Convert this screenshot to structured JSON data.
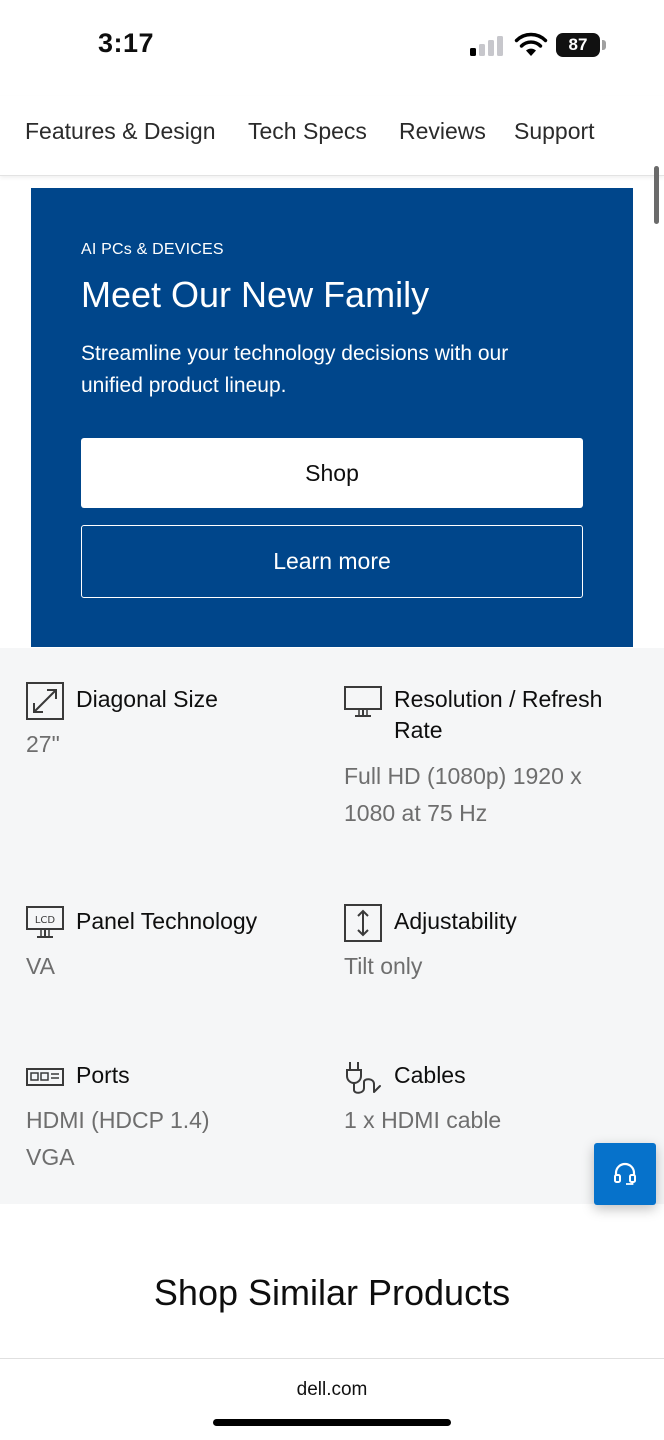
{
  "status_bar": {
    "time": "3:17",
    "battery": "87"
  },
  "tabs": [
    {
      "label": "Features & Design"
    },
    {
      "label": "Tech Specs"
    },
    {
      "label": "Reviews"
    },
    {
      "label": "Support"
    }
  ],
  "promo": {
    "eyebrow": "AI PCs & DEVICES",
    "title": "Meet Our New Family",
    "description": "Streamline your technology decisions with our unified product lineup.",
    "shop_label": "Shop",
    "learn_more_label": "Learn more",
    "background_color": "#00468b"
  },
  "specs": [
    {
      "label": "Diagonal Size",
      "value": "27\"",
      "icon": "diagonal-arrows-icon"
    },
    {
      "label": "Resolution / Refresh Rate",
      "value": "Full HD (1080p) 1920 x 1080 at 75 Hz",
      "icon": "monitor-icon"
    },
    {
      "label": "Panel Technology",
      "value": "VA",
      "icon": "lcd-icon"
    },
    {
      "label": "Adjustability",
      "value": "Tilt only",
      "icon": "vertical-adjust-icon"
    },
    {
      "label": "Ports",
      "value_lines": [
        "HDMI (HDCP 1.4)",
        "VGA"
      ],
      "icon": "ports-icon"
    },
    {
      "label": "Cables",
      "value": "1 x HDMI cable",
      "icon": "cable-icon"
    }
  ],
  "chat": {
    "icon": "headset-icon",
    "color": "#0672cb"
  },
  "similar_products": {
    "title": "Shop Similar Products"
  },
  "browser": {
    "url": "dell.com"
  }
}
